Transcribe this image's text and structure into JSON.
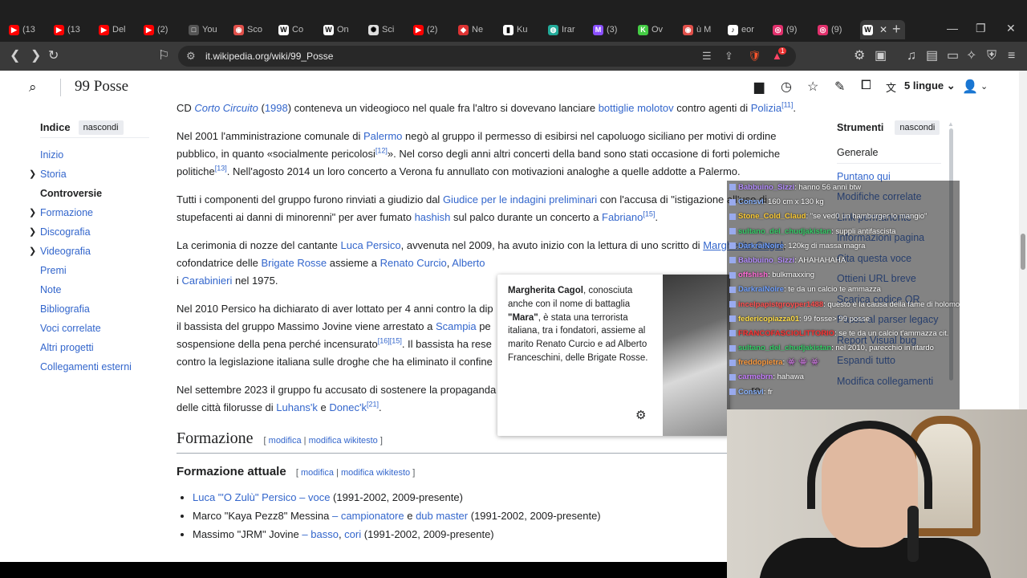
{
  "browser": {
    "tabs": [
      {
        "label": "(13",
        "icon": "youtube-icon",
        "color": "#ff0000"
      },
      {
        "label": "(13",
        "icon": "youtube-icon",
        "color": "#ff0000"
      },
      {
        "label": "Del",
        "icon": "youtube-icon",
        "color": "#ff0000"
      },
      {
        "label": "(2)",
        "icon": "youtube-icon",
        "color": "#ff0000"
      },
      {
        "label": "You",
        "icon": "page-icon",
        "color": "#555555"
      },
      {
        "label": "Sco",
        "icon": "brave-icon",
        "color": "#e0504a"
      },
      {
        "label": "Co",
        "icon": "wikipedia-icon",
        "color": "#ffffff"
      },
      {
        "label": "On",
        "icon": "wikipedia-icon",
        "color": "#ffffff"
      },
      {
        "label": "Sci",
        "icon": "openai-icon",
        "color": "#dddddd"
      },
      {
        "label": "(2)",
        "icon": "youtube-icon",
        "color": "#ff0000"
      },
      {
        "label": "Ne",
        "icon": "news-icon",
        "color": "#d33"
      },
      {
        "label": "Ku",
        "icon": "book-icon",
        "color": "#ffffff"
      },
      {
        "label": "Irar",
        "icon": "globe-icon",
        "color": "#2a9"
      },
      {
        "label": "(3)",
        "icon": "mail-icon",
        "color": "#8a4fff"
      },
      {
        "label": "Ov",
        "icon": "k-icon",
        "color": "#4c4"
      },
      {
        "label": "ù M",
        "icon": "brave-icon",
        "color": "#e0504a"
      },
      {
        "label": "eor",
        "icon": "tiktok-icon",
        "color": "#ffffff"
      },
      {
        "label": "(9)",
        "icon": "instagram-icon",
        "color": "#e1306c"
      },
      {
        "label": "(9)",
        "icon": "instagram-icon",
        "color": "#e1306c"
      }
    ],
    "active_tab_icon": "wikipedia-icon",
    "url": "it.wikipedia.org/wiki/99_Posse",
    "brave_badge": "1"
  },
  "wiki": {
    "site_title": "99 Posse",
    "lang_label": "5 lingue",
    "toc": {
      "title": "Indice",
      "hide": "nascondi",
      "items": [
        {
          "label": "Inizio",
          "expandable": false,
          "current": false
        },
        {
          "label": "Storia",
          "expandable": true,
          "current": false
        },
        {
          "label": "Controversie",
          "expandable": false,
          "current": true
        },
        {
          "label": "Formazione",
          "expandable": true,
          "current": false
        },
        {
          "label": "Discografia",
          "expandable": true,
          "current": false
        },
        {
          "label": "Videografia",
          "expandable": true,
          "current": false
        },
        {
          "label": "Premi",
          "expandable": false,
          "current": false
        },
        {
          "label": "Note",
          "expandable": false,
          "current": false
        },
        {
          "label": "Bibliografia",
          "expandable": false,
          "current": false
        },
        {
          "label": "Voci correlate",
          "expandable": false,
          "current": false
        },
        {
          "label": "Altri progetti",
          "expandable": false,
          "current": false
        },
        {
          "label": "Collegamenti esterni",
          "expandable": false,
          "current": false
        }
      ]
    },
    "tools": {
      "title": "Strumenti",
      "hide": "nascondi",
      "general": "Generale",
      "items": [
        "Puntano qui",
        "Modifiche correlate",
        "Link permanente",
        "Informazioni pagina",
        "Cita questa voce",
        "Ottieni URL breve",
        "Scarica codice QR",
        "Passa al parser legacy",
        "Report Visual bug",
        "Espandi tutto",
        "Modifica collegamenti"
      ]
    },
    "content": {
      "p1": {
        "t1": "CD ",
        "a1": "Corto Circuito",
        "t2": " (",
        "a2": "1998",
        "t3": ") conteneva un videogioco nel quale fra l'altro si dovevano lanciare ",
        "a3": "bottiglie molotov",
        "t4": " contro agenti di ",
        "a4": "Polizia",
        "ref": "[11]",
        "t5": "."
      },
      "p2": {
        "t1": "Nel 2001 l'amministrazione comunale di ",
        "a1": "Palermo",
        "t2": " negò al gruppo il permesso di esibirsi nel capoluogo siciliano per motivi di ordine pubblico, in quanto «socialmente pericolosi",
        "ref1": "[12]",
        "t3": "». Nel corso degli anni altri concerti della band sono stati occasione di forti polemiche politiche",
        "ref2": "[13]",
        "t4": ". Nell'agosto 2014 un loro concerto a Verona fu annullato con motivazioni analoghe a quelle addotte a Palermo."
      },
      "p3": {
        "t1": "Tutti i componenti del gruppo furono rinviati a giudizio dal ",
        "a1": "Giudice per le indagini preliminari",
        "t2": " con l'accusa di \"istigazione all'uso di stupefacenti ai danni di minorenni\" per aver fumato ",
        "a2": "hashish",
        "t3": " sul palco durante un concerto a ",
        "a3": "Fabriano",
        "ref": "[15]",
        "t4": "."
      },
      "p4": {
        "t1": "La cerimonia di nozze del cantante ",
        "a1": "Luca Persico",
        "t2": ", avvenuta nel 2009, ha avuto inizio con la lettura di uno scritto di ",
        "a2": "Margherita Cagol",
        "t3": ", cofondatrice delle ",
        "a3": "Brigate Rosse",
        "t4": " assieme a ",
        "a4": "Renato Curcio",
        "t5": ", ",
        "a5": "Alberto",
        "t6": " i ",
        "a6": "Carabinieri",
        "t7": " nel 1975."
      },
      "p5": {
        "t1": "Nel 2010 Persico ha dichiarato di aver lottato per 4 anni contro la dip",
        "t2": "il bassista del gruppo Massimo Jovine viene arrestato a ",
        "a1": "Scampia",
        "t3": " pe",
        "t4": "sospensione della pena perché incensurato",
        "ref": "[16][15]",
        "t5": ". Il bassista ha rese",
        "t6": "contro la legislazione italiana sulle droghe che ha eliminato il confine"
      },
      "p6": {
        "t1": "Nel settembre 2023 il gruppo fu accusato di sostenere la propaganda",
        "t2": "re",
        "t3": "delle città filorusse di ",
        "a1": "Luhans'k",
        "t4": " e ",
        "a2": "Donec'k",
        "ref": "[21]",
        "t5": "."
      },
      "h2": "Formazione",
      "edit1": "modifica",
      "edit2": "modifica wikitesto",
      "h3": "Formazione attuale",
      "members": [
        {
          "a1": "Luca \"'O Zulù\" Persico",
          "sep": " – ",
          "a2": "voce",
          "t": " (1991-2002, 2009-presente)"
        },
        {
          "plain": "Marco \"Kaya Pezz8\" Messina",
          "sep": " – ",
          "a2": "campionatore",
          "mid": " e ",
          "a3": "dub master",
          "t": " (1991-2002, 2009-presente)"
        },
        {
          "plain": "Massimo \"JRM\" Jovine",
          "sep": " – ",
          "a2": "basso",
          "mid": ", ",
          "a3": "cori",
          "t": " (1991-2002, 2009-presente)"
        }
      ]
    },
    "popup": {
      "name": "Margherita Cagol",
      "t1": ", conosciuta anche con il nome di battaglia ",
      "alias": "\"Mara\"",
      "t2": ", è stata una terrorista italiana, tra i fondatori, assieme al marito Renato Curcio e ad Alberto Franceschini, delle Brigate Rosse."
    }
  },
  "chat": [
    {
      "user": "Babbuino_Sizzi",
      "color": "#b48cff",
      "msg": ": hanno 56 anni btw"
    },
    {
      "user": "Consvl",
      "color": "#8ab4ff",
      "msg": ": 160 cm x 130 kg"
    },
    {
      "user": "Stone_Cold_Claud",
      "color": "#ffcc33",
      "msg": ": \"se ved0 un hamburger lo mangio\""
    },
    {
      "user": "sultano_del_chudjakistan",
      "color": "#33cc66",
      "msg": ": suppli antifascista"
    },
    {
      "user": "DarkraiNoire",
      "color": "#6fa0ff",
      "msg": ": 120kg di massa magra"
    },
    {
      "user": "Babbuino_Sizzi",
      "color": "#b48cff",
      "msg": ": AHAHAHAHA"
    },
    {
      "user": "offshish",
      "color": "#ff6ad5",
      "msg": ": bulkmaxxing"
    },
    {
      "user": "DarkraiNoire",
      "color": "#6fa0ff",
      "msg": ": te da un calcio te ammazza"
    },
    {
      "user": "incelpapistgroyper1488",
      "color": "#ff5050",
      "msg": ": questo è la causa della fame di holomodor"
    },
    {
      "user": "federicopiazza01",
      "color": "#ffdd44",
      "msg": ": 99 fosse> 99 posse"
    },
    {
      "user": "FRANCOFASCIOLITTORIO",
      "color": "#ff3333",
      "msg": ": se te da un calcio t'ammazza cit."
    },
    {
      "user": "sultano_del_chudjakistan",
      "color": "#33cc66",
      "msg": ": nel 2010, parecchio in ritardo"
    },
    {
      "user": "freddopietra",
      "color": "#ff9a3c",
      "msg": ": 👾 👾 👾"
    },
    {
      "user": "carmebrn",
      "color": "#c77dff",
      "msg": ": hahawa"
    },
    {
      "user": "Consvl",
      "color": "#8ab4ff",
      "msg": ": fr"
    }
  ]
}
